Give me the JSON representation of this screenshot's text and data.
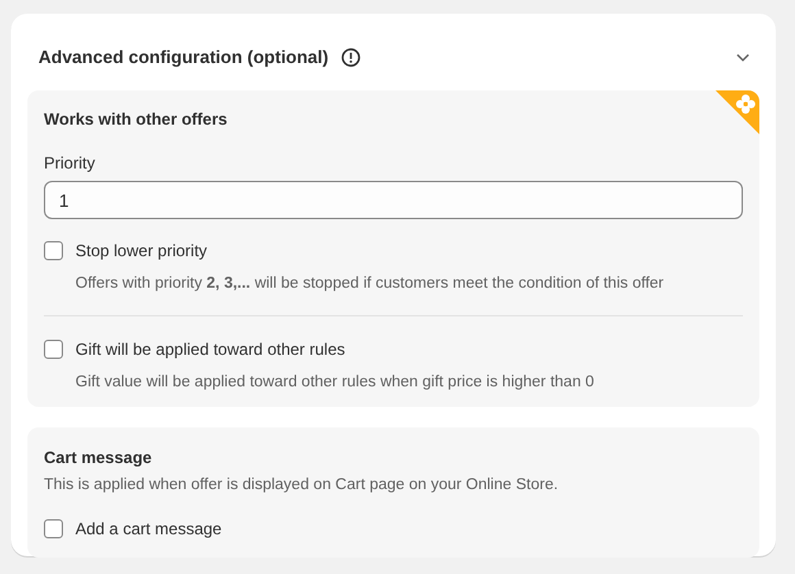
{
  "card": {
    "title": "Advanced configuration (optional)"
  },
  "offers_panel": {
    "title": "Works with other offers",
    "priority": {
      "label": "Priority",
      "value": "1"
    },
    "options": [
      {
        "label": "Stop lower priority",
        "description": "Offers with priority **2, 3,...** will be stopped if customers meet the condition of this offer",
        "checked": false
      },
      {
        "label": "Gift will be applied toward other rules",
        "description": "Gift value will be applied toward other rules when gift price is higher than 0",
        "checked": false
      }
    ]
  },
  "cart_panel": {
    "title": "Cart message",
    "description": "This is applied when offer is displayed on Cart page on your Online Store.",
    "options": [
      {
        "label": "Add a cart message",
        "checked": false
      }
    ]
  }
}
